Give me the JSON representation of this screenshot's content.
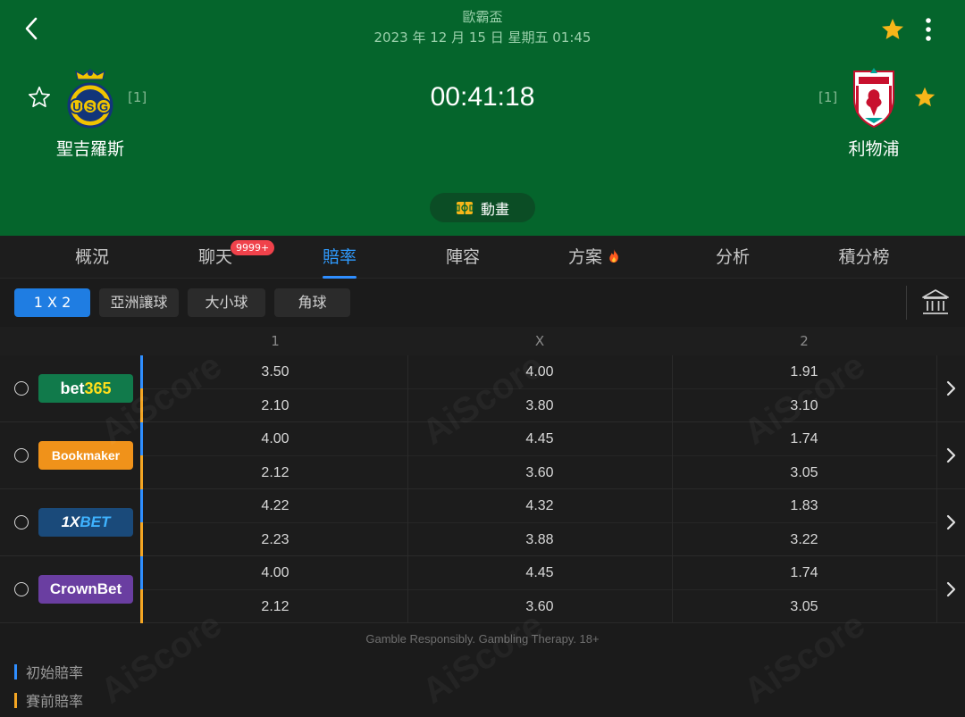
{
  "header": {
    "competition": "歐霸盃",
    "datetime": "2023 年 12 月 15 日 星期五 01:45",
    "clock": "00:41:18",
    "animation_label": "動畫",
    "home": {
      "name": "聖吉羅斯",
      "rank": "[1]",
      "logo_text": "USG",
      "favorited": false
    },
    "away": {
      "name": "利物浦",
      "rank": "[1]",
      "logo_text": "LIVERPOOL",
      "favorited": true
    }
  },
  "tabs": [
    {
      "label": "概況",
      "active": false
    },
    {
      "label": "聊天",
      "active": false,
      "badge": "9999+"
    },
    {
      "label": "賠率",
      "active": true
    },
    {
      "label": "陣容",
      "active": false
    },
    {
      "label": "方案",
      "active": false,
      "icon": "fire-icon"
    },
    {
      "label": "分析",
      "active": false
    },
    {
      "label": "積分榜",
      "active": false
    }
  ],
  "filters": [
    {
      "label": "1 X 2",
      "active": true
    },
    {
      "label": "亞洲讓球",
      "active": false
    },
    {
      "label": "大小球",
      "active": false
    },
    {
      "label": "角球",
      "active": false
    }
  ],
  "odds_table": {
    "columns": [
      "1",
      "X",
      "2"
    ],
    "bookmakers": [
      {
        "name": "bet365",
        "initial": [
          "3.50",
          "4.00",
          "1.91"
        ],
        "prematch": [
          "2.10",
          "3.80",
          "3.10"
        ]
      },
      {
        "name": "Bookmaker",
        "initial": [
          "4.00",
          "4.45",
          "1.74"
        ],
        "prematch": [
          "2.12",
          "3.60",
          "3.05"
        ]
      },
      {
        "name": "1XBET",
        "initial": [
          "4.22",
          "4.32",
          "1.83"
        ],
        "prematch": [
          "2.23",
          "3.88",
          "3.22"
        ]
      },
      {
        "name": "CrownBet",
        "initial": [
          "4.00",
          "4.45",
          "1.74"
        ],
        "prematch": [
          "2.12",
          "3.60",
          "3.05"
        ]
      }
    ]
  },
  "footer_note": "Gamble Responsibly. Gambling Therapy. 18+",
  "legend": [
    {
      "label": "初始賠率",
      "color": "#2f8eff"
    },
    {
      "label": "賽前賠率",
      "color": "#f5a623"
    }
  ],
  "watermark": "AiScore",
  "colors": {
    "header_bg": "#05652c",
    "accent_blue": "#2f8eff",
    "accent_orange": "#f5a623",
    "star_gold": "#f7b619",
    "badge_red": "#f0424b"
  }
}
